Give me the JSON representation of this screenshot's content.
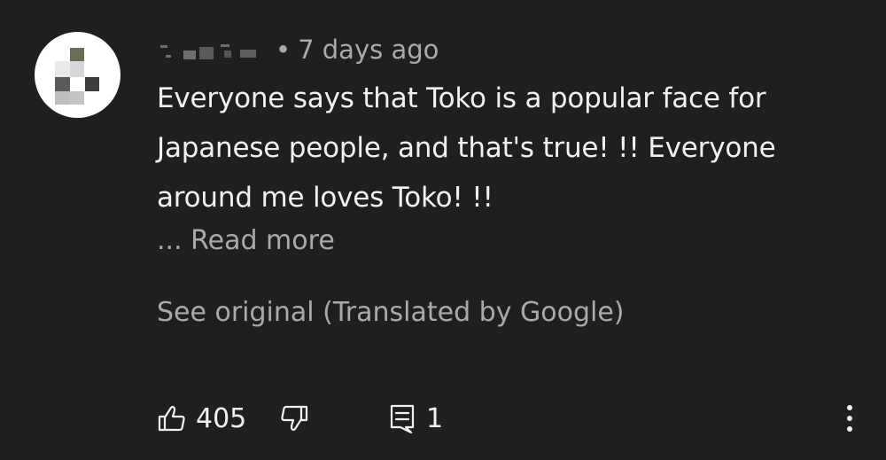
{
  "comment": {
    "author": "",
    "separator": "•",
    "timestamp": "7 days ago",
    "body_lines": [
      "Everyone says that Toko is a popular face for",
      "Japanese people, and that's true! !! Everyone",
      "around me loves Toko! !!"
    ],
    "read_more_label": "... Read more",
    "see_original_label": "See original (Translated by Google)"
  },
  "actions": {
    "like_count": "405",
    "reply_count": "1",
    "like_icon": "thumbs-up-icon",
    "dislike_icon": "thumbs-down-icon",
    "reply_icon": "reply-comment-icon",
    "more_icon": "more-vertical-icon"
  },
  "colors": {
    "background": "#1f1f1f",
    "primary_text": "#f1f1f1",
    "secondary_text": "#aaaaaa",
    "avatar_background": "#ffffff"
  }
}
